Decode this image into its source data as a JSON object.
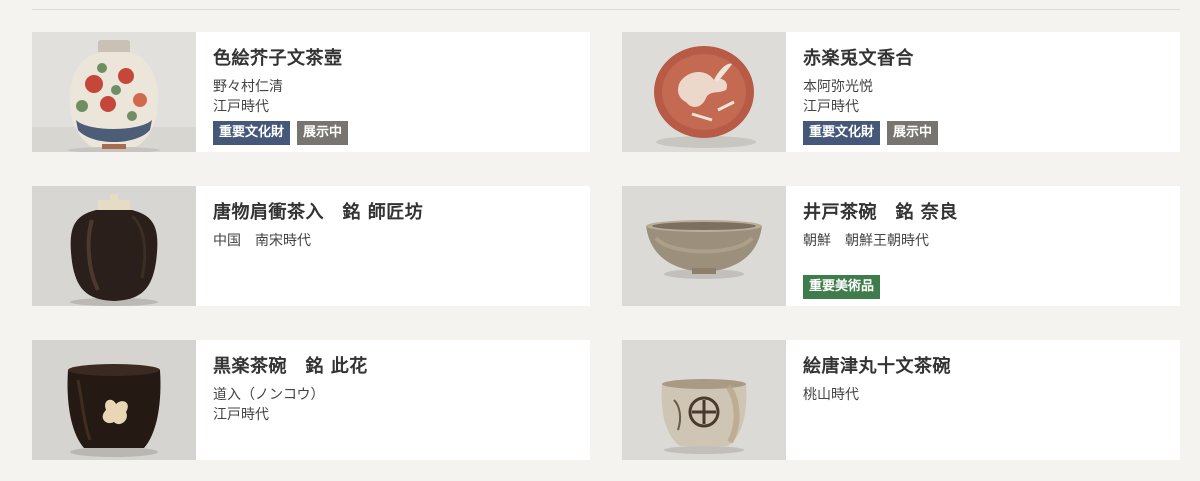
{
  "items": [
    {
      "title": "色絵芥子文茶壺",
      "lines": [
        "野々村仁清",
        "江戸時代"
      ],
      "badges": [
        {
          "label": "重要文化財",
          "color": "#45587a"
        },
        {
          "label": "展示中",
          "color": "#787570"
        }
      ]
    },
    {
      "title": "赤楽兎文香合",
      "lines": [
        "本阿弥光悦",
        "江戸時代"
      ],
      "badges": [
        {
          "label": "重要文化財",
          "color": "#45587a"
        },
        {
          "label": "展示中",
          "color": "#787570"
        }
      ]
    },
    {
      "title": "唐物肩衝茶入　銘 師匠坊",
      "lines": [
        "中国　南宋時代"
      ],
      "badges": []
    },
    {
      "title": "井戸茶碗　銘 奈良",
      "lines": [
        "朝鮮　朝鮮王朝時代"
      ],
      "badges": [
        {
          "label": "重要美術品",
          "color": "#3f7c4c"
        }
      ]
    },
    {
      "title": "黒楽茶碗　銘 此花",
      "lines": [
        "道入（ノンコウ）",
        "江戸時代"
      ],
      "badges": []
    },
    {
      "title": "絵唐津丸十文茶碗",
      "lines": [
        "桃山時代"
      ],
      "badges": []
    }
  ]
}
